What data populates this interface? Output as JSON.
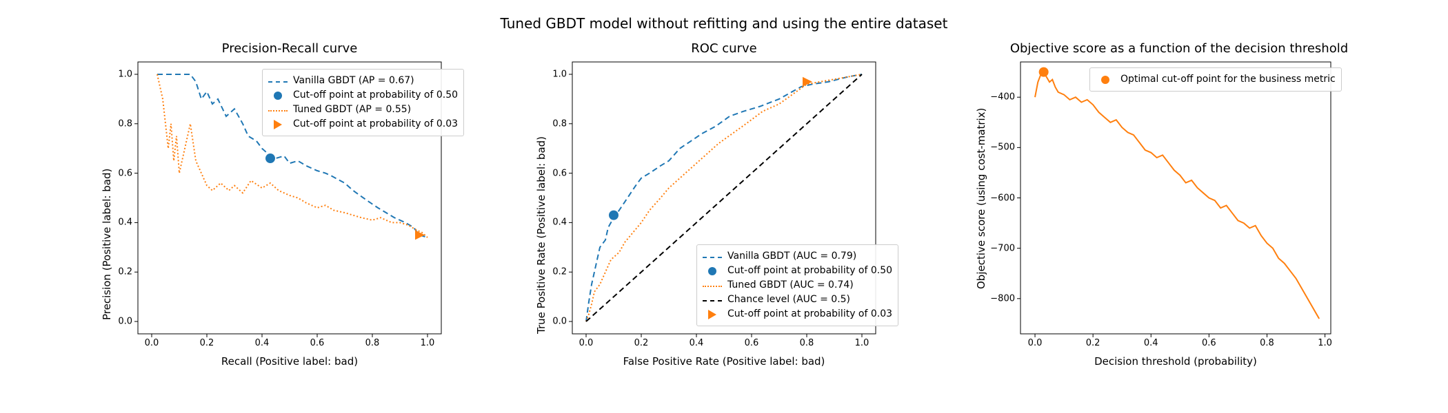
{
  "suptitle": "Tuned GBDT model without refitting and using the entire dataset",
  "colors": {
    "blue": "#1f77b4",
    "orange": "#ff7f0e",
    "black": "#000000",
    "axis": "#000000",
    "spine_gray": "#b0b0b0"
  },
  "panels": {
    "pr": {
      "title": "Precision-Recall curve",
      "xlabel": "Recall (Positive label: bad)",
      "ylabel": "Precision (Positive label: bad)",
      "legend": {
        "vanilla": "Vanilla GBDT (AP = 0.67)",
        "cut_vanilla": "Cut-off point at probability of 0.50",
        "tuned": "Tuned GBDT (AP = 0.55)",
        "cut_tuned": "Cut-off point at probability of 0.03"
      }
    },
    "roc": {
      "title": "ROC curve",
      "xlabel": "False Positive Rate (Positive label: bad)",
      "ylabel": "True Positive Rate (Positive label: bad)",
      "legend": {
        "vanilla": "Vanilla GBDT (AUC = 0.79)",
        "cut_vanilla": "Cut-off point at probability of 0.50",
        "tuned": "Tuned GBDT (AUC = 0.74)",
        "chance": "Chance level (AUC = 0.5)",
        "cut_tuned": "Cut-off point at probability of 0.03"
      }
    },
    "obj": {
      "title": "Objective score as a function of the decision threshold",
      "xlabel": "Decision threshold (probability)",
      "ylabel": "Objective score (using cost-matrix)",
      "legend": {
        "optimal": "Optimal cut-off point for the business metric"
      }
    }
  },
  "chart_data": [
    {
      "id": "precision_recall",
      "type": "line",
      "xlabel": "Recall (Positive label: bad)",
      "ylabel": "Precision (Positive label: bad)",
      "title": "Precision-Recall curve",
      "xlim": [
        -0.05,
        1.05
      ],
      "ylim": [
        -0.05,
        1.05
      ],
      "xticks": [
        0.0,
        0.2,
        0.4,
        0.6,
        0.8,
        1.0
      ],
      "yticks": [
        0.0,
        0.2,
        0.4,
        0.6,
        0.8,
        1.0
      ],
      "series": [
        {
          "name": "Vanilla GBDT (AP = 0.67)",
          "color": "blue",
          "style": "dashed",
          "x": [
            0.02,
            0.04,
            0.06,
            0.08,
            0.1,
            0.12,
            0.14,
            0.16,
            0.18,
            0.2,
            0.22,
            0.24,
            0.27,
            0.3,
            0.33,
            0.35,
            0.38,
            0.4,
            0.43,
            0.45,
            0.48,
            0.5,
            0.53,
            0.56,
            0.6,
            0.63,
            0.65,
            0.7,
            0.73,
            0.78,
            0.82,
            0.85,
            0.88,
            0.92,
            0.95,
            0.97,
            1.0
          ],
          "y": [
            1.0,
            1.0,
            1.0,
            1.0,
            1.0,
            1.0,
            1.0,
            0.97,
            0.9,
            0.93,
            0.88,
            0.9,
            0.83,
            0.86,
            0.8,
            0.75,
            0.73,
            0.7,
            0.67,
            0.66,
            0.67,
            0.64,
            0.65,
            0.63,
            0.61,
            0.6,
            0.59,
            0.56,
            0.53,
            0.49,
            0.46,
            0.44,
            0.42,
            0.4,
            0.38,
            0.35,
            0.34
          ]
        },
        {
          "name": "Tuned GBDT (AP = 0.55)",
          "color": "orange",
          "style": "dotted",
          "x": [
            0.02,
            0.04,
            0.05,
            0.06,
            0.07,
            0.08,
            0.09,
            0.1,
            0.12,
            0.14,
            0.16,
            0.18,
            0.2,
            0.22,
            0.25,
            0.28,
            0.3,
            0.33,
            0.36,
            0.4,
            0.43,
            0.46,
            0.5,
            0.53,
            0.56,
            0.6,
            0.63,
            0.66,
            0.7,
            0.73,
            0.76,
            0.8,
            0.83,
            0.87,
            0.9,
            0.93,
            0.96,
            0.98,
            1.0
          ],
          "y": [
            1.0,
            0.9,
            0.8,
            0.7,
            0.8,
            0.65,
            0.75,
            0.6,
            0.7,
            0.8,
            0.65,
            0.6,
            0.55,
            0.53,
            0.56,
            0.53,
            0.55,
            0.52,
            0.57,
            0.54,
            0.56,
            0.53,
            0.51,
            0.5,
            0.48,
            0.46,
            0.47,
            0.45,
            0.44,
            0.43,
            0.42,
            0.41,
            0.42,
            0.4,
            0.4,
            0.39,
            0.37,
            0.36,
            0.34
          ]
        }
      ],
      "markers": [
        {
          "name": "Cut-off point at probability of 0.50",
          "color": "blue",
          "shape": "circle",
          "x": 0.43,
          "y": 0.66
        },
        {
          "name": "Cut-off point at probability of 0.03",
          "color": "orange",
          "shape": "triangle-right",
          "x": 0.97,
          "y": 0.35
        }
      ]
    },
    {
      "id": "roc",
      "type": "line",
      "xlabel": "False Positive Rate (Positive label: bad)",
      "ylabel": "True Positive Rate (Positive label: bad)",
      "title": "ROC curve",
      "xlim": [
        -0.05,
        1.05
      ],
      "ylim": [
        -0.05,
        1.05
      ],
      "xticks": [
        0.0,
        0.2,
        0.4,
        0.6,
        0.8,
        1.0
      ],
      "yticks": [
        0.0,
        0.2,
        0.4,
        0.6,
        0.8,
        1.0
      ],
      "series": [
        {
          "name": "Vanilla GBDT (AUC = 0.79)",
          "color": "blue",
          "style": "dashed",
          "x": [
            0.0,
            0.01,
            0.02,
            0.03,
            0.04,
            0.05,
            0.07,
            0.08,
            0.1,
            0.12,
            0.15,
            0.18,
            0.2,
            0.23,
            0.27,
            0.3,
            0.34,
            0.38,
            0.42,
            0.47,
            0.52,
            0.57,
            0.63,
            0.7,
            0.78,
            0.82,
            0.88,
            0.95,
            1.0
          ],
          "y": [
            0.0,
            0.08,
            0.15,
            0.2,
            0.25,
            0.3,
            0.33,
            0.38,
            0.42,
            0.45,
            0.5,
            0.55,
            0.58,
            0.6,
            0.63,
            0.65,
            0.7,
            0.73,
            0.76,
            0.79,
            0.83,
            0.85,
            0.87,
            0.9,
            0.95,
            0.96,
            0.97,
            0.99,
            1.0
          ]
        },
        {
          "name": "Tuned GBDT (AUC = 0.74)",
          "color": "orange",
          "style": "dotted",
          "x": [
            0.0,
            0.01,
            0.02,
            0.03,
            0.05,
            0.07,
            0.09,
            0.12,
            0.14,
            0.17,
            0.2,
            0.23,
            0.27,
            0.3,
            0.34,
            0.38,
            0.43,
            0.48,
            0.53,
            0.58,
            0.64,
            0.7,
            0.75,
            0.8,
            0.85,
            0.9,
            0.95,
            1.0
          ],
          "y": [
            0.0,
            0.03,
            0.07,
            0.12,
            0.15,
            0.2,
            0.25,
            0.28,
            0.32,
            0.36,
            0.4,
            0.45,
            0.5,
            0.54,
            0.58,
            0.62,
            0.67,
            0.72,
            0.76,
            0.8,
            0.85,
            0.88,
            0.92,
            0.96,
            0.97,
            0.98,
            0.99,
            1.0
          ]
        },
        {
          "name": "Chance level (AUC = 0.5)",
          "color": "black",
          "style": "dashed",
          "x": [
            0.0,
            1.0
          ],
          "y": [
            0.0,
            1.0
          ]
        }
      ],
      "markers": [
        {
          "name": "Cut-off point at probability of 0.50",
          "color": "blue",
          "shape": "circle",
          "x": 0.1,
          "y": 0.43
        },
        {
          "name": "Cut-off point at probability of 0.03",
          "color": "orange",
          "shape": "triangle-right",
          "x": 0.8,
          "y": 0.97
        }
      ]
    },
    {
      "id": "objective",
      "type": "line",
      "xlabel": "Decision threshold (probability)",
      "ylabel": "Objective score (using cost-matrix)",
      "title": "Objective score as a function of the decision threshold",
      "xlim": [
        -0.05,
        1.02
      ],
      "ylim": [
        -870,
        -330
      ],
      "xticks": [
        0.0,
        0.2,
        0.4,
        0.6,
        0.8,
        1.0
      ],
      "yticks": [
        -800,
        -700,
        -600,
        -500,
        -400
      ],
      "series": [
        {
          "name": "Objective score",
          "color": "orange",
          "style": "solid",
          "x": [
            0.0,
            0.01,
            0.02,
            0.03,
            0.04,
            0.05,
            0.06,
            0.07,
            0.08,
            0.1,
            0.12,
            0.14,
            0.16,
            0.18,
            0.2,
            0.22,
            0.24,
            0.26,
            0.28,
            0.3,
            0.32,
            0.34,
            0.36,
            0.38,
            0.4,
            0.42,
            0.44,
            0.46,
            0.48,
            0.5,
            0.52,
            0.54,
            0.56,
            0.58,
            0.6,
            0.62,
            0.64,
            0.66,
            0.68,
            0.7,
            0.72,
            0.74,
            0.76,
            0.78,
            0.8,
            0.82,
            0.84,
            0.86,
            0.88,
            0.9,
            0.92,
            0.94,
            0.96,
            0.98
          ],
          "y": [
            -400,
            -370,
            -355,
            -350,
            -360,
            -370,
            -365,
            -380,
            -390,
            -395,
            -405,
            -400,
            -410,
            -405,
            -415,
            -430,
            -440,
            -450,
            -445,
            -460,
            -470,
            -475,
            -490,
            -505,
            -510,
            -520,
            -515,
            -530,
            -545,
            -555,
            -570,
            -565,
            -580,
            -590,
            -600,
            -605,
            -620,
            -615,
            -630,
            -645,
            -650,
            -660,
            -655,
            -675,
            -690,
            -700,
            -720,
            -730,
            -745,
            -760,
            -780,
            -800,
            -820,
            -840
          ]
        }
      ],
      "markers": [
        {
          "name": "Optimal cut-off point for the business metric",
          "color": "orange",
          "shape": "circle",
          "x": 0.03,
          "y": -350
        }
      ]
    }
  ]
}
